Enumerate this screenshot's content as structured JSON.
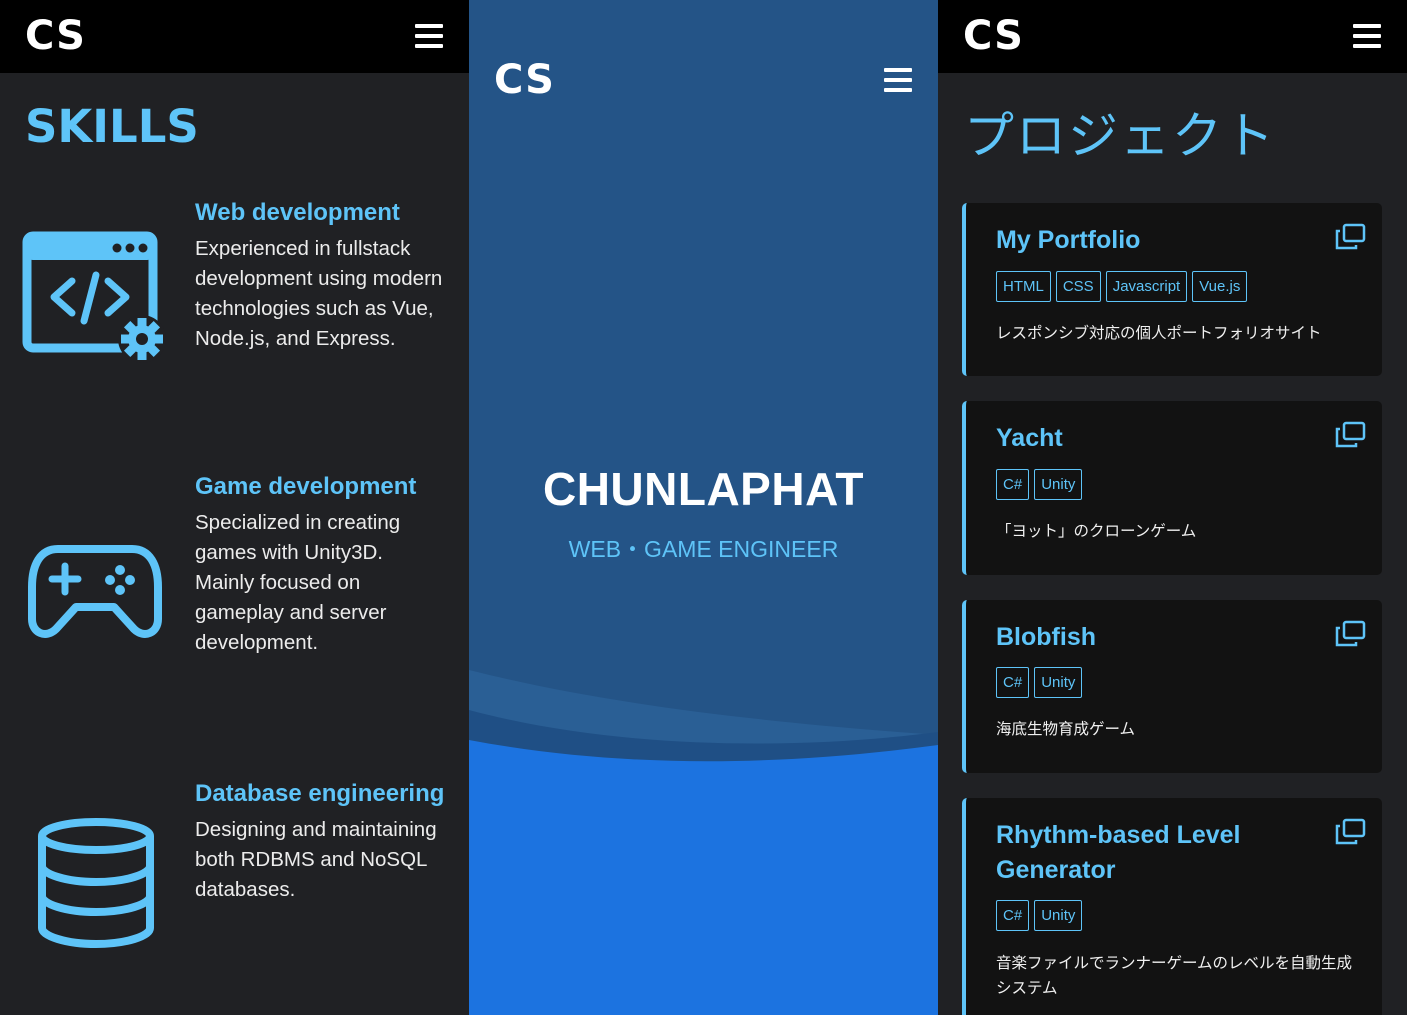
{
  "skills_panel": {
    "logo": "CS",
    "title": "SKILLS",
    "items": [
      {
        "title": "Web development",
        "description": "Experienced in fullstack development using modern technologies such as Vue, Node.js, and Express.",
        "icon": "web-development-icon"
      },
      {
        "title": "Game development",
        "description": "Specialized in creating games with Unity3D. Mainly focused on gameplay and server development.",
        "icon": "gamepad-icon"
      },
      {
        "title": "Database engineering",
        "description": "Designing and maintaining both RDBMS and NoSQL databases.",
        "icon": "database-icon"
      }
    ]
  },
  "hero_panel": {
    "logo": "CS",
    "name": "CHUNLAPHAT",
    "subtitle": "WEB・GAME ENGINEER"
  },
  "projects_panel": {
    "logo": "CS",
    "title": "プロジェクト",
    "projects": [
      {
        "title": "My Portfolio",
        "tags": [
          "HTML",
          "CSS",
          "Javascript",
          "Vue.js"
        ],
        "description": "レスポンシブ対応の個人ポートフォリオサイト"
      },
      {
        "title": "Yacht",
        "tags": [
          "C#",
          "Unity"
        ],
        "description": "「ヨット」のクローンゲーム"
      },
      {
        "title": "Blobfish",
        "tags": [
          "C#",
          "Unity"
        ],
        "description": "海底生物育成ゲーム"
      },
      {
        "title": "Rhythm-based Level Generator",
        "tags": [
          "C#",
          "Unity"
        ],
        "description": "音楽ファイルでランナーゲームのレベルを自動生成システム"
      }
    ]
  },
  "colors": {
    "accent": "#5ec4f8",
    "panel_dark": "#202124",
    "topbar": "#000000",
    "hero_blue": "#245487",
    "wave_blue": "#1c73e0",
    "card": "#121212"
  }
}
